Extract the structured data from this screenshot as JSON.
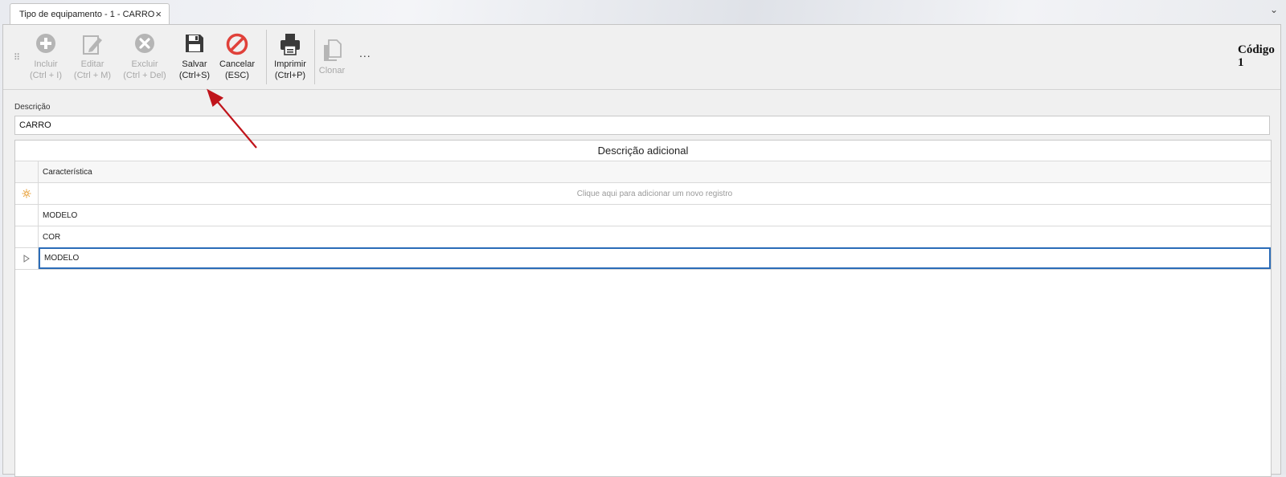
{
  "tab": {
    "title": "Tipo de equipamento - 1 - CARRO",
    "close": "×"
  },
  "window": {
    "menu_chevron": "⌄"
  },
  "toolbar": {
    "buttons": [
      {
        "l1": "Incluir",
        "l2": "(Ctrl + I)"
      },
      {
        "l1": "Editar",
        "l2": "(Ctrl + M)"
      },
      {
        "l1": "Excluir",
        "l2": "(Ctrl + Del)"
      },
      {
        "l1": "Salvar",
        "l2": "(Ctrl+S)"
      },
      {
        "l1": "Cancelar",
        "l2": "(ESC)"
      },
      {
        "l1": "Imprimir",
        "l2": "(Ctrl+P)"
      },
      {
        "l1": "Clonar",
        "l2": ""
      }
    ],
    "more": "..."
  },
  "header": {
    "code_label": "Código",
    "code_value": "1"
  },
  "form": {
    "descricao_label": "Descrição",
    "descricao_value": "CARRO"
  },
  "grid": {
    "title": "Descrição adicional",
    "column": "Característica",
    "new_row_hint": "Clique aqui para adicionar um novo registro",
    "rows": [
      "MODELO",
      "COR",
      "MODELO"
    ]
  },
  "colors": {
    "accent": "#2b6cb8",
    "cancel": "#e0413a",
    "annotation_arrow": "#c0141b"
  }
}
